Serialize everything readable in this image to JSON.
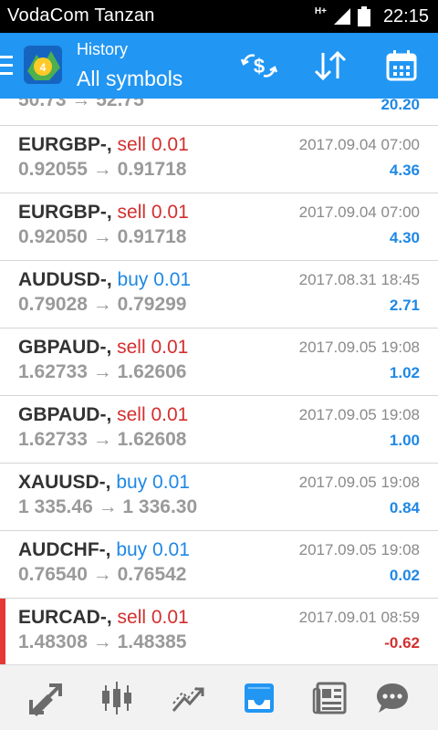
{
  "status_bar": {
    "carrier": "VodaCom Tanzan",
    "network": "H+",
    "time": "22:15"
  },
  "app_bar": {
    "title": "History",
    "subtitle": "All symbols",
    "colors": {
      "background": "#2196f3"
    }
  },
  "list": {
    "partial_row": {
      "prices": "50.73 → 52.75",
      "profit": "20.20"
    },
    "rows": [
      {
        "symbol": "EURGBP-,",
        "side": "sell 0.01",
        "type": "sell",
        "prices": "0.92055 → 0.91718",
        "date": "2017.09.04 07:00",
        "profit": "4.36",
        "profit_sign": "pos"
      },
      {
        "symbol": "EURGBP-,",
        "side": "sell 0.01",
        "type": "sell",
        "prices": "0.92050 → 0.91718",
        "date": "2017.09.04 07:00",
        "profit": "4.30",
        "profit_sign": "pos"
      },
      {
        "symbol": "AUDUSD-,",
        "side": "buy 0.01",
        "type": "buy",
        "prices": "0.79028 → 0.79299",
        "date": "2017.08.31 18:45",
        "profit": "2.71",
        "profit_sign": "pos"
      },
      {
        "symbol": "GBPAUD-,",
        "side": "sell 0.01",
        "type": "sell",
        "prices": "1.62733 → 1.62606",
        "date": "2017.09.05 19:08",
        "profit": "1.02",
        "profit_sign": "pos"
      },
      {
        "symbol": "GBPAUD-,",
        "side": "sell 0.01",
        "type": "sell",
        "prices": "1.62733 → 1.62608",
        "date": "2017.09.05 19:08",
        "profit": "1.00",
        "profit_sign": "pos"
      },
      {
        "symbol": "XAUUSD-,",
        "side": "buy 0.01",
        "type": "buy",
        "prices": "1 335.46 → 1 336.30",
        "date": "2017.09.05 19:08",
        "profit": "0.84",
        "profit_sign": "pos"
      },
      {
        "symbol": "AUDCHF-,",
        "side": "buy 0.01",
        "type": "buy",
        "prices": "0.76540 → 0.76542",
        "date": "2017.09.05 19:08",
        "profit": "0.02",
        "profit_sign": "pos"
      },
      {
        "symbol": "EURCAD-,",
        "side": "sell 0.01",
        "type": "sell",
        "prices": "1.48308 → 1.48385",
        "date": "2017.09.01 08:59",
        "profit": "-0.62",
        "profit_sign": "neg"
      }
    ]
  },
  "bottom_nav": {
    "items": [
      {
        "icon": "quotes-icon",
        "active": false
      },
      {
        "icon": "chart-icon",
        "active": false
      },
      {
        "icon": "trade-icon",
        "active": false
      },
      {
        "icon": "history-icon",
        "active": true
      },
      {
        "icon": "news-icon",
        "active": false
      },
      {
        "icon": "chat-icon",
        "active": false
      }
    ],
    "colors": {
      "active": "#2196f3",
      "inactive": "#6b6b6b"
    }
  }
}
